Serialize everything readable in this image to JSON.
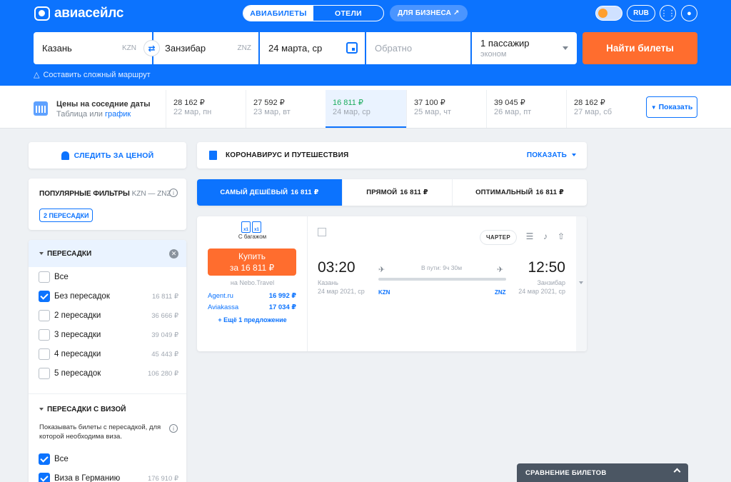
{
  "header": {
    "logo_text": "авиасейлс",
    "tabs": [
      {
        "label": "АВИАБИЛЕТЫ",
        "active": true
      },
      {
        "label": "ОТЕЛИ",
        "active": false
      }
    ],
    "business_label": "ДЛЯ БИЗНЕСА ↗",
    "currency_label": "RUB",
    "search": {
      "origin": "Казань",
      "origin_code": "KZN",
      "destination": "Занзибар",
      "destination_code": "ZNZ",
      "depart_date": "24 марта, ср",
      "return_placeholder": "Обратно",
      "passengers": "1 пассажир",
      "cabin_class": "эконом",
      "find_label": "Найти билеты"
    },
    "complex_route_label": "Составить сложный маршрут"
  },
  "price_calendar": {
    "title": "Цены на соседние даты",
    "sub_table": "Таблица",
    "sub_or": " или ",
    "sub_chart": "график",
    "dates": [
      {
        "price": "28 162 ₽",
        "date": "22 мар, пн",
        "active": false
      },
      {
        "price": "27 592 ₽",
        "date": "23 мар, вт",
        "active": false
      },
      {
        "price": "16 811 ₽",
        "date": "24 мар, ср",
        "active": true
      },
      {
        "price": "37 100 ₽",
        "date": "25 мар, чт",
        "active": false
      },
      {
        "price": "39 045 ₽",
        "date": "26 мар, пт",
        "active": false
      },
      {
        "price": "28 162 ₽",
        "date": "27 мар, сб",
        "active": false
      }
    ],
    "show_label": "Показать"
  },
  "sidebar": {
    "follow_price_label": "СЛЕДИТЬ ЗА ЦЕНОЙ",
    "popular_filters": {
      "title": "ПОПУЛЯРНЫЕ ФИЛЬТРЫ",
      "route": "KZN — ZNZ",
      "chip": "2 ПЕРЕСАДКИ"
    },
    "stops": {
      "title": "ПЕРЕСАДКИ",
      "items": [
        {
          "label": "Все",
          "price": "",
          "checked": false
        },
        {
          "label": "Без пересадок",
          "price": "16 811 ₽",
          "checked": true
        },
        {
          "label": "2 пересадки",
          "price": "36 666 ₽",
          "checked": false
        },
        {
          "label": "3 пересадки",
          "price": "39 049 ₽",
          "checked": false
        },
        {
          "label": "4 пересадки",
          "price": "45 443 ₽",
          "checked": false
        },
        {
          "label": "5 пересадок",
          "price": "106 280 ₽",
          "checked": false
        }
      ]
    },
    "visa": {
      "title": "ПЕРЕСАДКИ С ВИЗОЙ",
      "description": "Показывать билеты с пересадкой, для которой необходима виза.",
      "items": [
        {
          "label": "Все",
          "price": "",
          "checked": true
        },
        {
          "label": "Виза в Германию",
          "price": "176 910 ₽",
          "checked": true
        }
      ]
    }
  },
  "covid": {
    "title": "КОРОНАВИРУС И ПУТЕШЕСТВИЯ",
    "show_label": "ПОКАЗАТЬ"
  },
  "sort_tabs": [
    {
      "label": "САМЫЙ ДЕШЁВЫЙ",
      "price": "16 811 ₽",
      "active": true
    },
    {
      "label": "ПРЯМОЙ",
      "price": "16 811 ₽",
      "active": false
    },
    {
      "label": "ОПТИМАЛЬНЫЙ",
      "price": "16 811 ₽",
      "active": false
    }
  ],
  "ticket": {
    "bag_count_1": "x1",
    "bag_count_2": "x1",
    "baggage_label": "С багажом",
    "buy_line1": "Купить",
    "buy_line2": "за 16 811 ₽",
    "via": "на Nebo.Travel",
    "agents": [
      {
        "name": "Agent.ru",
        "price": "16 992 ₽"
      },
      {
        "name": "Aviakassa",
        "price": "17 034 ₽"
      }
    ],
    "more_offers": "+ Ещё 1 предложение",
    "charter_label": "ЧАРТЕР",
    "departure_time": "03:20",
    "departure_city": "Казань",
    "departure_date": "24 мар 2021, ср",
    "departure_code": "KZN",
    "duration": "В пути: 9ч 30м",
    "arrival_time": "12:50",
    "arrival_city": "Занзибар",
    "arrival_date": "24 мар 2021, ср",
    "arrival_code": "ZNZ"
  },
  "compare_bar_label": "СРАВНЕНИЕ БИЛЕТОВ",
  "colors": {
    "brand_blue": "#0c73fe",
    "cta_orange": "#ff6d2e",
    "price_green": "#1ead5f"
  }
}
